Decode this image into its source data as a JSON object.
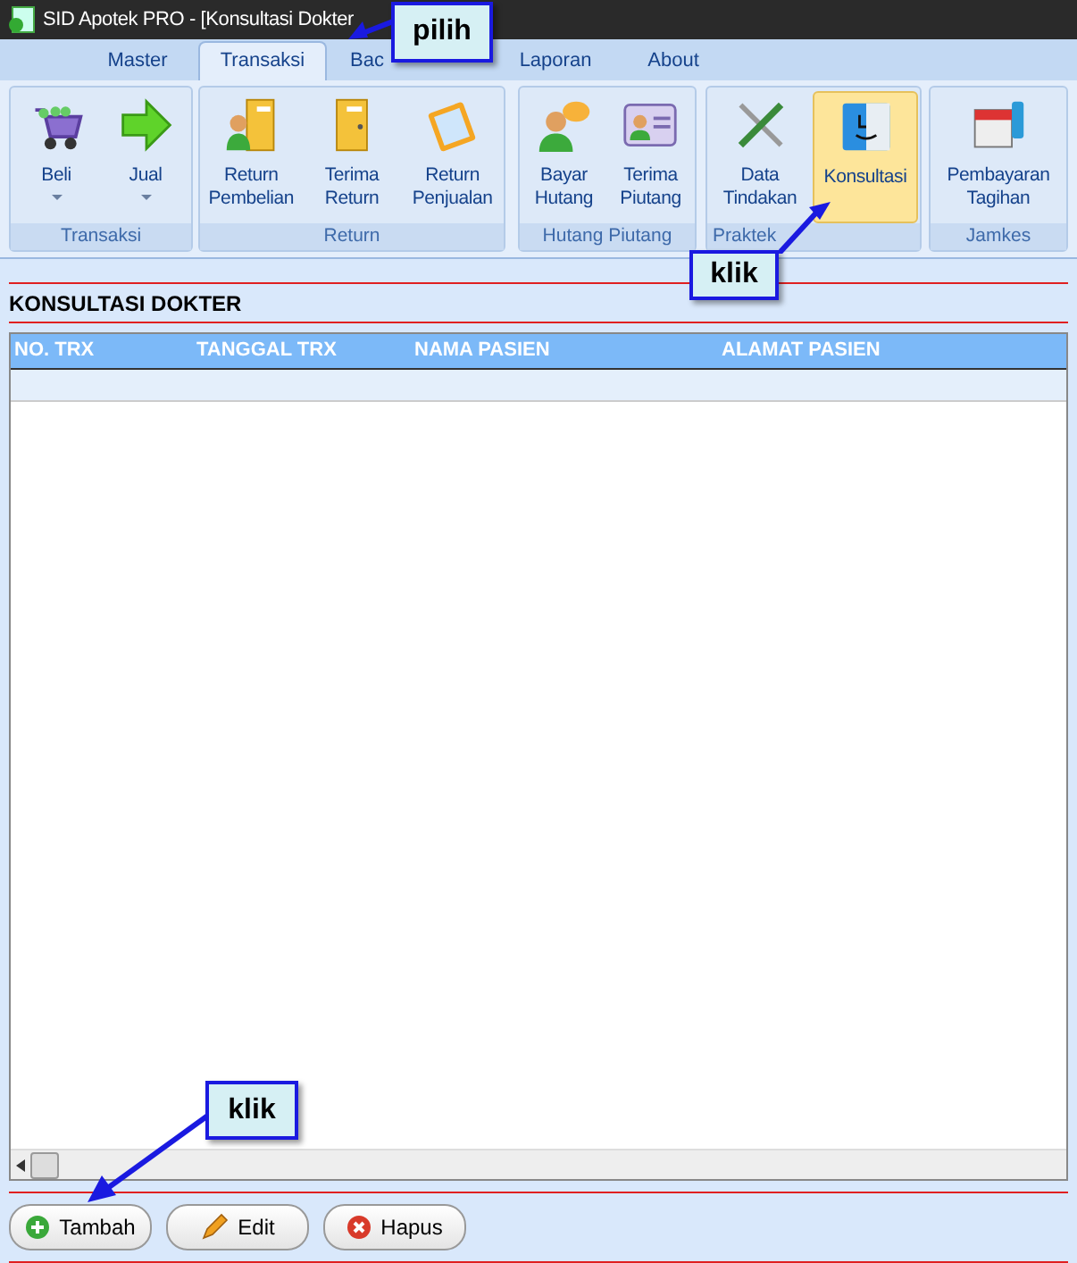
{
  "window": {
    "title": "SID Apotek PRO - [Konsultasi Dokter"
  },
  "tabs": [
    {
      "label": "Master",
      "selected": false
    },
    {
      "label": "Transaksi",
      "selected": true
    },
    {
      "label": "Bac",
      "selected": false
    },
    {
      "label": "Laporan",
      "selected": false
    },
    {
      "label": "About",
      "selected": false
    }
  ],
  "ribbon_groups": [
    {
      "label": "Transaksi",
      "buttons": [
        {
          "label": "Beli",
          "dropdown": true,
          "selected": false
        },
        {
          "label": "Jual",
          "dropdown": true,
          "selected": false
        }
      ]
    },
    {
      "label": "Return",
      "buttons": [
        {
          "label": "Return Pembelian",
          "dropdown": false,
          "selected": false
        },
        {
          "label": "Terima Return",
          "dropdown": false,
          "selected": false
        },
        {
          "label": "Return Penjualan",
          "dropdown": false,
          "selected": false
        }
      ]
    },
    {
      "label": "Hutang Piutang",
      "buttons": [
        {
          "label": "Bayar Hutang",
          "dropdown": false,
          "selected": false
        },
        {
          "label": "Terima Piutang",
          "dropdown": false,
          "selected": false
        }
      ]
    },
    {
      "label": "Praktek",
      "buttons": [
        {
          "label": "Data Tindakan",
          "dropdown": false,
          "selected": false
        },
        {
          "label": "Konsultasi",
          "dropdown": false,
          "selected": true
        }
      ]
    },
    {
      "label": "Jamkes",
      "buttons": [
        {
          "label": "Pembayaran Tagihan",
          "dropdown": false,
          "selected": false
        }
      ]
    }
  ],
  "heading": "KONSULTASI DOKTER",
  "table": {
    "columns": [
      "NO. TRX",
      "TANGGAL TRX",
      "NAMA PASIEN",
      "ALAMAT PASIEN"
    ]
  },
  "buttons": [
    {
      "label": "Tambah",
      "kind": "add"
    },
    {
      "label": "Edit",
      "kind": "edit"
    },
    {
      "label": "Hapus",
      "kind": "delete"
    }
  ],
  "callouts": [
    {
      "text": "pilih"
    },
    {
      "text": "klik"
    },
    {
      "text": "klik"
    }
  ]
}
